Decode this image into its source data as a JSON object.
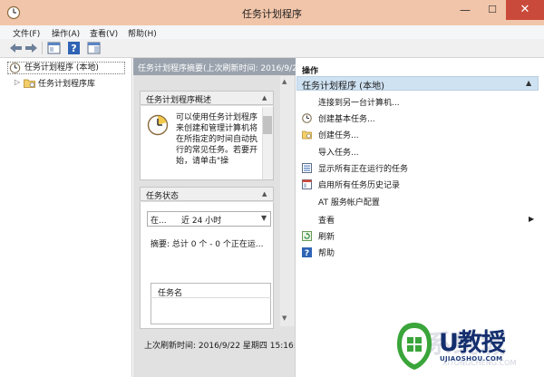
{
  "window": {
    "title": "任务计划程序",
    "controls": {
      "minimize": "—",
      "maximize": "☐",
      "close": "✕"
    }
  },
  "menu": [
    "文件(F)",
    "操作(A)",
    "查看(V)",
    "帮助(H)"
  ],
  "toolbar": {
    "icons": [
      "back-arrow-icon",
      "forward-arrow-icon",
      "console-tree-icon",
      "help-icon",
      "action-pane-icon"
    ]
  },
  "tree": {
    "root": "任务计划程序 (本地)",
    "child": "任务计划程序库"
  },
  "center": {
    "header": "任务计划程序摘要(上次刷新时间: 2016/9/2",
    "overview": {
      "title": "任务计划程序概述",
      "text": "可以使用任务计划程序来创建和管理计算机将在所指定的时间自动执行的常见任务。若要开始，请单击\"操"
    },
    "status": {
      "title": "任务状态",
      "range_prefix": "在...",
      "range_value": "近 24 小时",
      "summary": "摘要: 总计 0 个 - 0 个正在运...",
      "table_column": "任务名"
    },
    "last_refresh": "上次刷新时间: 2016/9/22 星期四 15:16:"
  },
  "actions": {
    "title": "操作",
    "section": "任务计划程序 (本地)",
    "items": [
      {
        "label": "连接到另一台计算机...",
        "icon": ""
      },
      {
        "label": "创建基本任务...",
        "icon": "calendar-wizard-icon"
      },
      {
        "label": "创建任务...",
        "icon": "create-task-icon"
      },
      {
        "label": "导入任务...",
        "icon": ""
      },
      {
        "label": "显示所有正在运行的任务",
        "icon": "running-tasks-icon"
      },
      {
        "label": "启用所有任务历史记录",
        "icon": "history-icon"
      },
      {
        "label": "AT 服务帐户配置",
        "icon": ""
      },
      {
        "label": "查看",
        "icon": ""
      },
      {
        "label": "刷新",
        "icon": "refresh-icon"
      },
      {
        "label": "帮助",
        "icon": "help-icon"
      }
    ]
  },
  "watermark": {
    "logo_text": "U教授",
    "logo_url": "UJIAOSHOU.COM",
    "faint_text": "系统城",
    "faint_url": "XITONGCHENG.COM"
  },
  "colors": {
    "titlebar": "#f1c5a9",
    "close_button": "#c94a3b",
    "center_header": "#9aa2ad",
    "actions_band": "#cfe2f2",
    "logo_green": "#3aa53a",
    "logo_navy": "#142f6e"
  }
}
